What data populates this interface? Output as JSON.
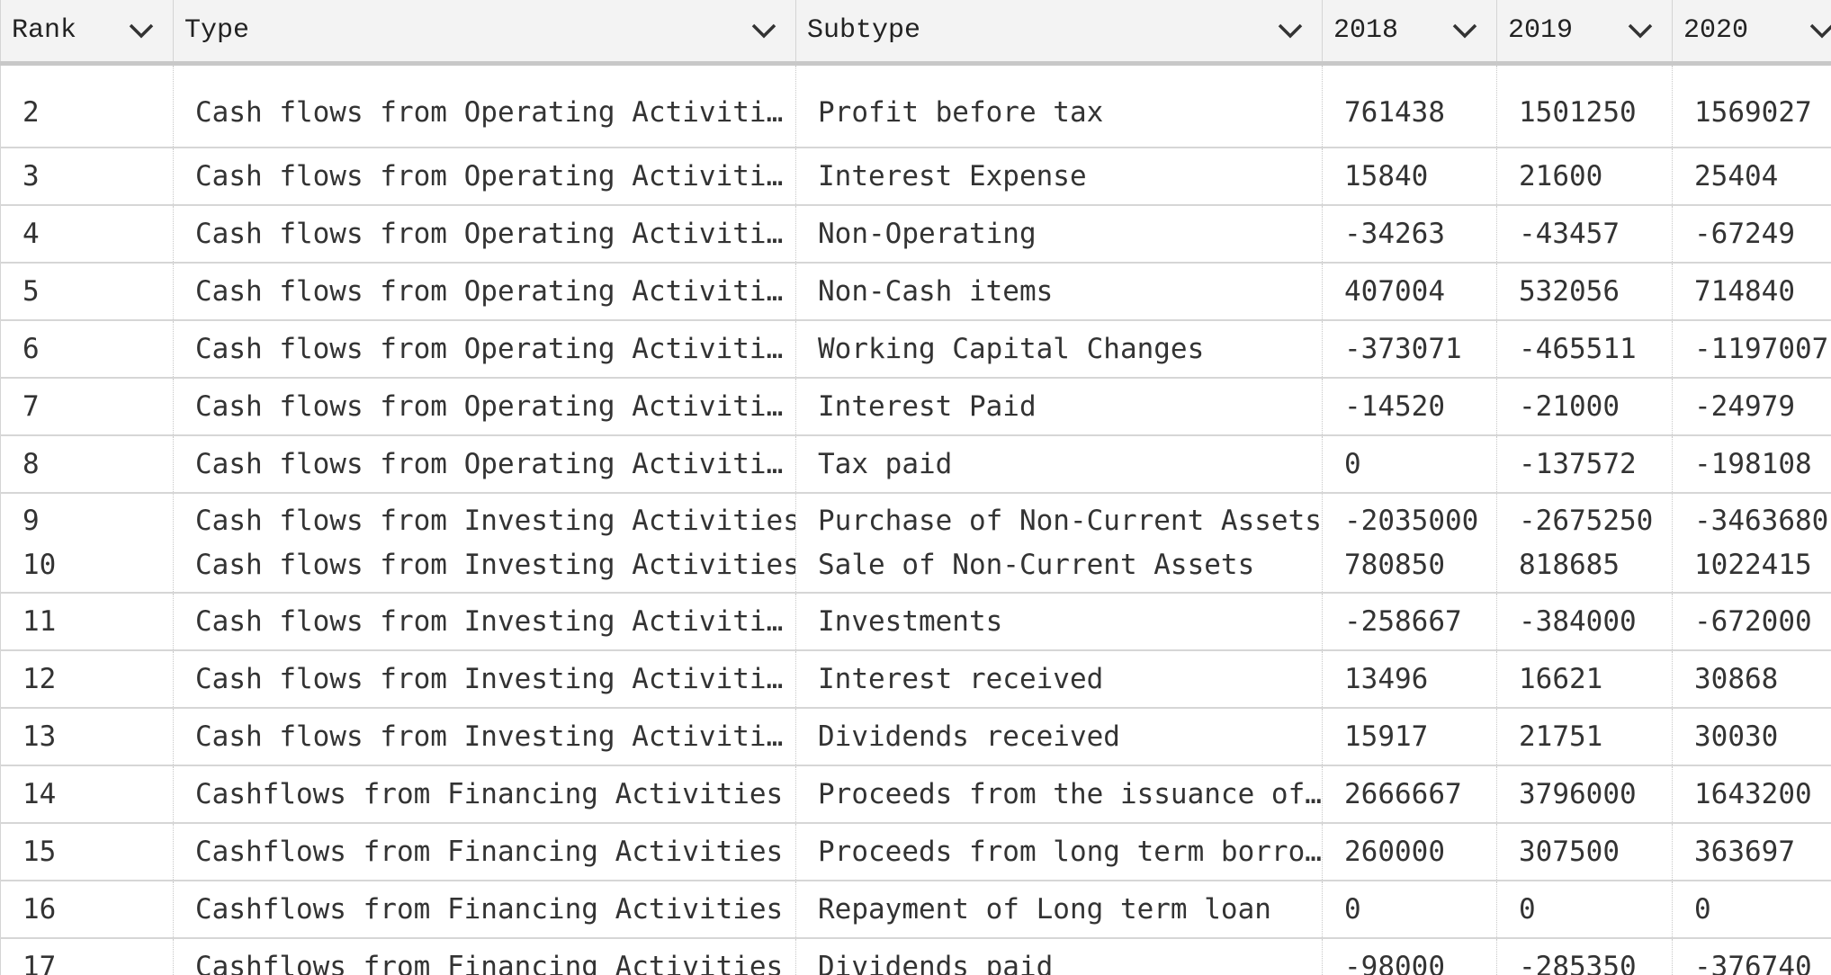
{
  "grid": {
    "columns": [
      {
        "key": "rank",
        "label": "Rank"
      },
      {
        "key": "type",
        "label": "Type"
      },
      {
        "key": "subtype",
        "label": "Subtype"
      },
      {
        "key": "y2018",
        "label": "2018"
      },
      {
        "key": "y2019",
        "label": "2019"
      },
      {
        "key": "y2020",
        "label": "2020"
      }
    ],
    "rows": [
      {
        "rank": "2",
        "type": "Cash flows from Operating Activities",
        "subtype": "Profit before tax",
        "y2018": "761438",
        "y2019": "1501250",
        "y2020": "1569027"
      },
      {
        "rank": "3",
        "type": "Cash flows from Operating Activities",
        "subtype": "Interest Expense",
        "y2018": "15840",
        "y2019": "21600",
        "y2020": "25404"
      },
      {
        "rank": "4",
        "type": "Cash flows from Operating Activities",
        "subtype": "Non-Operating",
        "y2018": "-34263",
        "y2019": "-43457",
        "y2020": "-67249"
      },
      {
        "rank": "5",
        "type": "Cash flows from Operating Activities",
        "subtype": "Non-Cash items",
        "y2018": "407004",
        "y2019": "532056",
        "y2020": "714840"
      },
      {
        "rank": "6",
        "type": "Cash flows from Operating Activities",
        "subtype": "Working Capital Changes",
        "y2018": "-373071",
        "y2019": "-465511",
        "y2020": "-1197007"
      },
      {
        "rank": "7",
        "type": "Cash flows from Operating Activities",
        "subtype": "Interest Paid",
        "y2018": "-14520",
        "y2019": "-21000",
        "y2020": "-24979"
      },
      {
        "rank": "8",
        "type": "Cash flows from Operating Activities",
        "subtype": "Tax paid",
        "y2018": "0",
        "y2019": "-137572",
        "y2020": "-198108"
      },
      {
        "rank": "9",
        "type": "Cash flows from Investing Activities",
        "subtype": "Purchase of Non-Current Assets",
        "y2018": "-2035000",
        "y2019": "-2675250",
        "y2020": "-3463680"
      },
      {
        "rank": "10",
        "type": "Cash flows from Investing Activities",
        "subtype": "Sale of Non-Current Assets",
        "y2018": "780850",
        "y2019": "818685",
        "y2020": "1022415"
      },
      {
        "rank": "11",
        "type": "Cash flows from Investing Activities",
        "subtype": "Investments",
        "y2018": "-258667",
        "y2019": "-384000",
        "y2020": "-672000"
      },
      {
        "rank": "12",
        "type": "Cash flows from Investing Activities",
        "subtype": "Interest received",
        "y2018": "13496",
        "y2019": "16621",
        "y2020": "30868"
      },
      {
        "rank": "13",
        "type": "Cash flows from Investing Activities",
        "subtype": "Dividends received",
        "y2018": "15917",
        "y2019": "21751",
        "y2020": "30030"
      },
      {
        "rank": "14",
        "type": "Cashflows from Financing Activities",
        "subtype": "Proceeds from the issuance of…",
        "y2018": "2666667",
        "y2019": "3796000",
        "y2020": "1643200"
      },
      {
        "rank": "15",
        "type": "Cashflows from Financing Activities",
        "subtype": "Proceeds from long term borro…",
        "y2018": "260000",
        "y2019": "307500",
        "y2020": "363697"
      },
      {
        "rank": "16",
        "type": "Cashflows from Financing Activities",
        "subtype": "Repayment of Long term loan",
        "y2018": "0",
        "y2019": "0",
        "y2020": "0"
      },
      {
        "rank": "17",
        "type": "Cashflows from Financing Activities",
        "subtype": "Dividends paid",
        "y2018": "-98000",
        "y2019": "-285350",
        "y2020": "-376740"
      }
    ]
  },
  "icons": {
    "sort": "chevron-down-icon"
  },
  "colors": {
    "header_bg": "#f3f3f3",
    "text": "#333333",
    "grid_line": "#d6d6d6"
  }
}
